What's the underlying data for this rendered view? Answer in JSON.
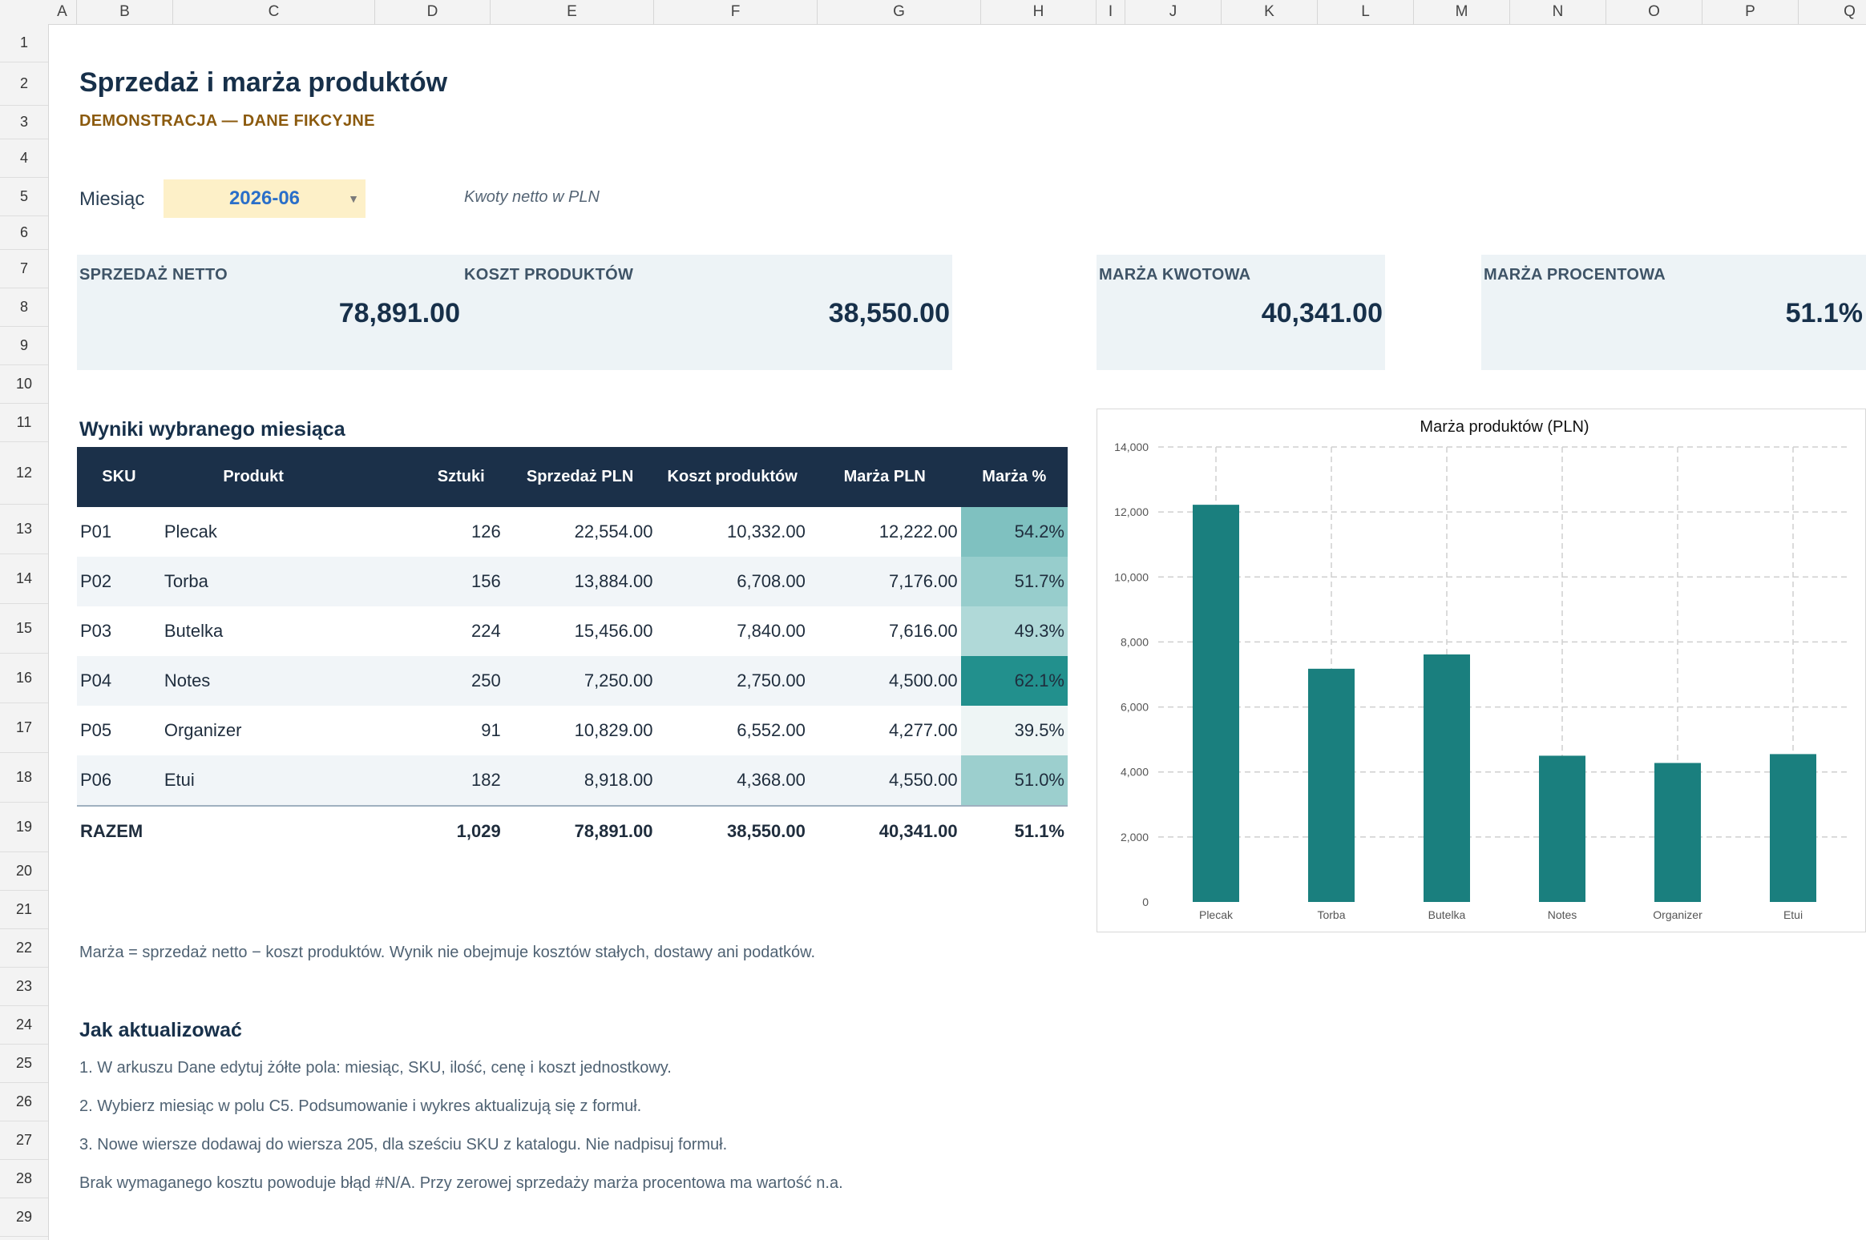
{
  "columns": [
    "A",
    "B",
    "C",
    "D",
    "E",
    "F",
    "G",
    "H",
    "I",
    "J",
    "K",
    "L",
    "M",
    "N",
    "O",
    "P",
    "Q"
  ],
  "rows": [
    "1",
    "2",
    "3",
    "4",
    "5",
    "6",
    "7",
    "8",
    "9",
    "10",
    "11",
    "12",
    "13",
    "14",
    "15",
    "16",
    "17",
    "18",
    "19",
    "20",
    "21",
    "22",
    "23",
    "24",
    "25",
    "26",
    "27",
    "28",
    "29"
  ],
  "header": {
    "title": "Sprzedaż i marża produktów",
    "subtitle": "DEMONSTRACJA — DANE FIKCYJNE"
  },
  "filter": {
    "label": "Miesiąc",
    "value": "2026-06",
    "note": "Kwoty netto w PLN"
  },
  "kpis": [
    {
      "label": "SPRZEDAŻ NETTO",
      "value": "78,891.00"
    },
    {
      "label": "KOSZT PRODUKTÓW",
      "value": "38,550.00"
    },
    {
      "label": "MARŻA KWOTOWA",
      "value": "40,341.00"
    },
    {
      "label": "MARŻA PROCENTOWA",
      "value": "51.1%"
    }
  ],
  "table": {
    "heading": "Wyniki wybranego miesiąca",
    "columns": [
      "SKU",
      "Produkt",
      "Sztuki",
      "Sprzedaż PLN",
      "Koszt produktów",
      "Marża PLN",
      "Marża %"
    ],
    "rows": [
      {
        "sku": "P01",
        "product": "Plecak",
        "units": "126",
        "sales": "22,554.00",
        "cost": "10,332.00",
        "margin": "12,222.00",
        "pct": "54.2%",
        "pct_color": "#7fc1c0"
      },
      {
        "sku": "P02",
        "product": "Torba",
        "units": "156",
        "sales": "13,884.00",
        "cost": "6,708.00",
        "margin": "7,176.00",
        "pct": "51.7%",
        "pct_color": "#97cdcc"
      },
      {
        "sku": "P03",
        "product": "Butelka",
        "units": "224",
        "sales": "15,456.00",
        "cost": "7,840.00",
        "margin": "7,616.00",
        "pct": "49.3%",
        "pct_color": "#b0d9d8"
      },
      {
        "sku": "P04",
        "product": "Notes",
        "units": "250",
        "sales": "7,250.00",
        "cost": "2,750.00",
        "margin": "4,500.00",
        "pct": "62.1%",
        "pct_color": "#22908d"
      },
      {
        "sku": "P05",
        "product": "Organizer",
        "units": "91",
        "sales": "10,829.00",
        "cost": "6,552.00",
        "margin": "4,277.00",
        "pct": "39.5%",
        "pct_color": "#eef5f5"
      },
      {
        "sku": "P06",
        "product": "Etui",
        "units": "182",
        "sales": "8,918.00",
        "cost": "4,368.00",
        "margin": "4,550.00",
        "pct": "51.0%",
        "pct_color": "#9ccfce"
      }
    ],
    "total": {
      "label": "RAZEM",
      "units": "1,029",
      "sales": "78,891.00",
      "cost": "38,550.00",
      "margin": "40,341.00",
      "pct": "51.1%"
    }
  },
  "formula_note": "Marża = sprzedaż netto − koszt produktów. Wynik nie obejmuje kosztów stałych, dostawy ani podatków.",
  "howto": {
    "heading": "Jak aktualizować",
    "lines": [
      "1. W arkuszu Dane edytuj żółte pola: miesiąc, SKU, ilość, cenę i koszt jednostkowy.",
      "2. Wybierz miesiąc w polu C5. Podsumowanie i wykres aktualizują się z formuł.",
      "3. Nowe wiersze dodawaj do wiersza 205, dla sześciu SKU z katalogu. Nie nadpisuj formuł.",
      "Brak wymaganego kosztu powoduje błąd #N/A. Przy zerowej sprzedaży marża procentowa ma wartość n.a."
    ]
  },
  "colors": {
    "accent": "#1a7f7e",
    "header_bg": "#1b3049",
    "input_yellow": "#fdf0c8",
    "kpi_bg": "#edf3f6"
  },
  "chart_data": {
    "type": "bar",
    "title": "Marża produktów (PLN)",
    "categories": [
      "Plecak",
      "Torba",
      "Butelka",
      "Notes",
      "Organizer",
      "Etui"
    ],
    "values": [
      12222,
      7176,
      7616,
      4500,
      4277,
      4550
    ],
    "ylim": [
      0,
      14000
    ],
    "yticks": [
      "0",
      "2,000",
      "4,000",
      "6,000",
      "8,000",
      "10,000",
      "12,000",
      "14,000"
    ],
    "grid": true,
    "legend": "none",
    "bar_color": "#1a7f7e"
  }
}
